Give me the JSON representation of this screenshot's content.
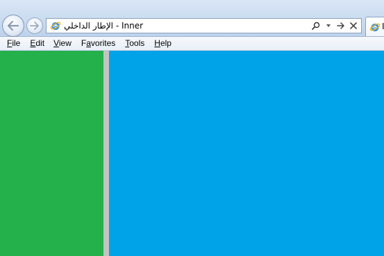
{
  "address_bar": {
    "text": "الإطار الداخلي - Inner"
  },
  "tab": {
    "label": "I"
  },
  "menu": {
    "items": [
      {
        "accel": "F",
        "rest": "ile"
      },
      {
        "accel": "E",
        "rest": "dit"
      },
      {
        "accel": "V",
        "rest": "iew"
      },
      {
        "pre": "F",
        "accel": "a",
        "rest": "vorites"
      },
      {
        "accel": "T",
        "rest": "ools"
      },
      {
        "accel": "H",
        "rest": "elp"
      }
    ]
  },
  "colors": {
    "left_frame": "#24b14b",
    "right_frame": "#00a2e8",
    "splitter": "#c3c3c3"
  },
  "icons": {
    "back": "back-arrow-icon",
    "forward": "forward-arrow-icon",
    "page": "internet-explorer-icon",
    "search": "search-icon",
    "dropdown": "dropdown-arrow-icon",
    "go": "go-arrow-icon",
    "stop": "close-icon"
  }
}
